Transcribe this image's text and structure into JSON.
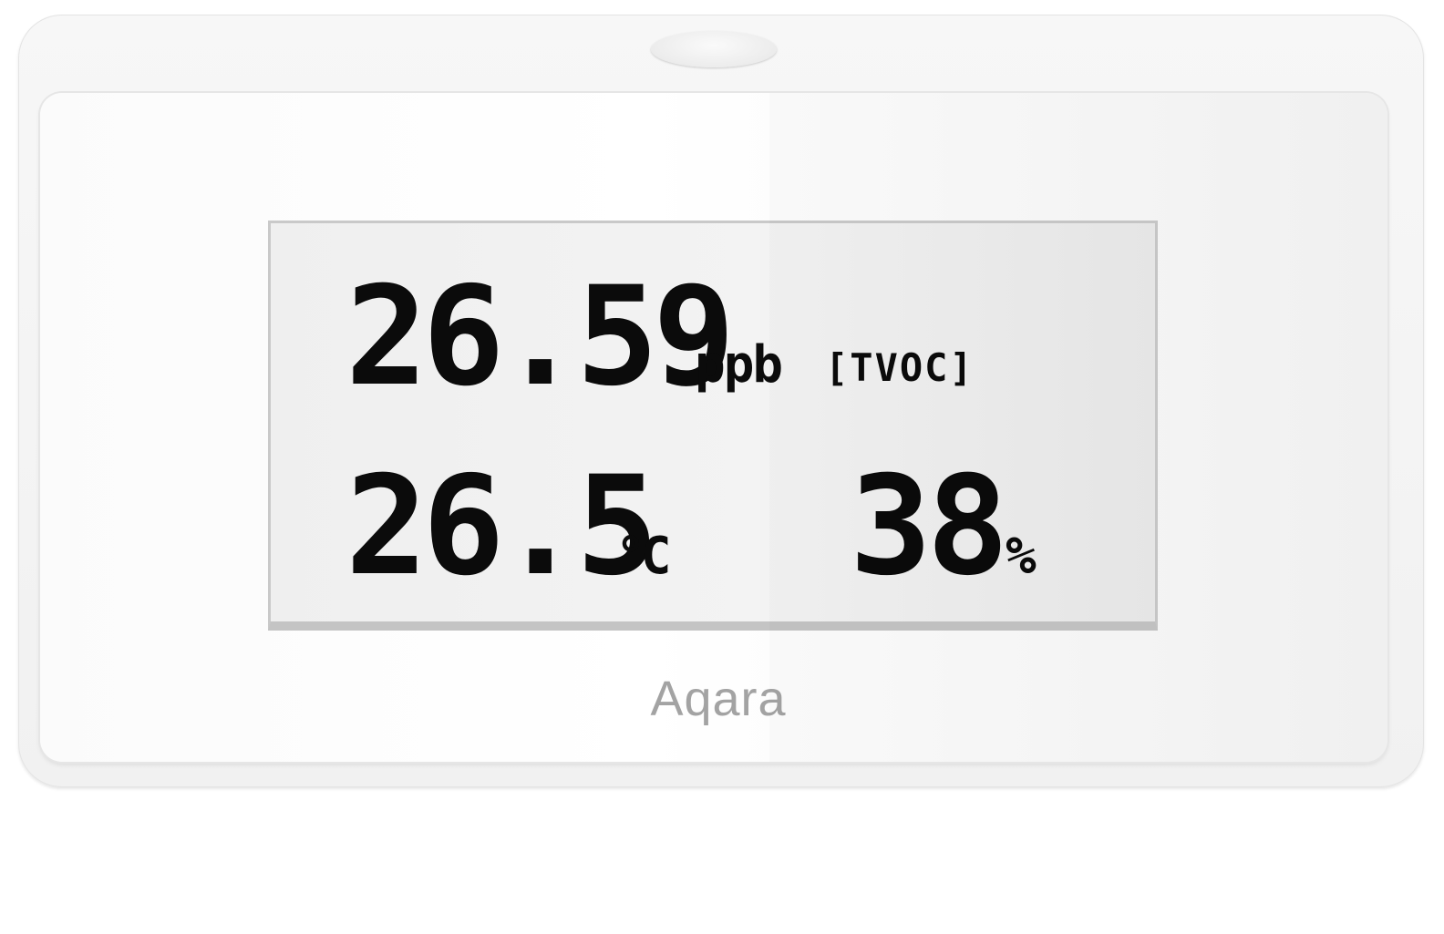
{
  "display": {
    "tvoc_value": "26.59",
    "tvoc_unit": "ppb",
    "tvoc_label": "[TVOC]",
    "temperature_value": "26.5",
    "temperature_unit": "°C",
    "humidity_value": "38",
    "humidity_unit": "%"
  },
  "brand": {
    "logo_text": "Aqara"
  },
  "colors": {
    "device_body": "#f3f3f3",
    "screen_background": "#eeeeee",
    "segment_ink": "#0b0b0b",
    "logo_gray": "#a3a3a3"
  }
}
